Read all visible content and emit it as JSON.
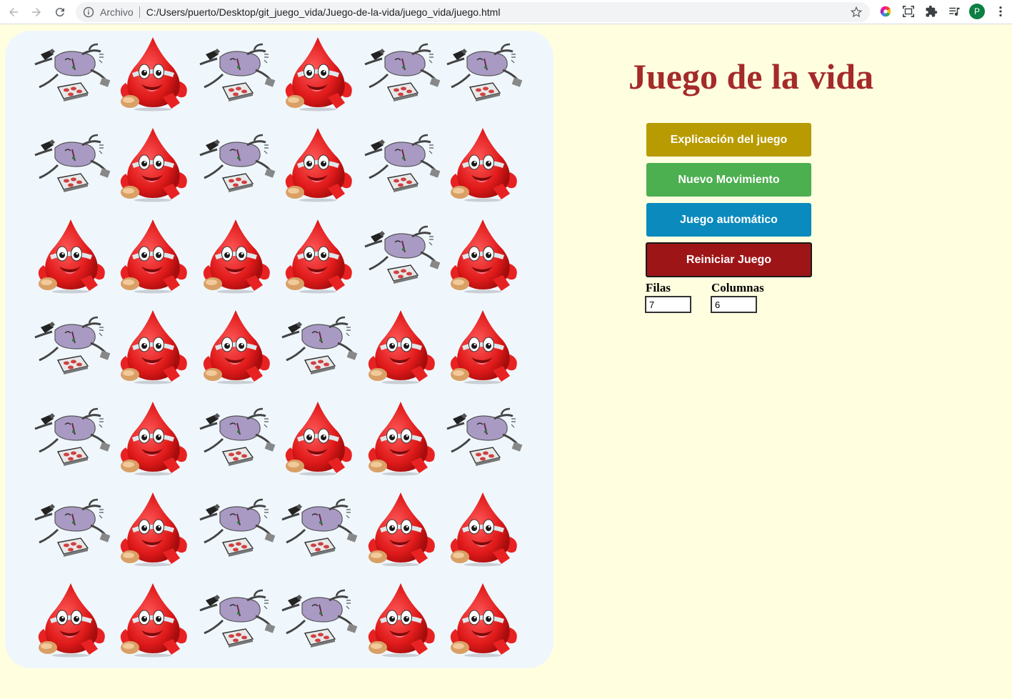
{
  "browser": {
    "protocol_label": "Archivo",
    "url": "C:/Users/puerto/Desktop/git_juego_vida/Juego-de-la-vida/juego_vida/juego.html",
    "profile_initial": "P"
  },
  "page": {
    "title": "Juego de la vida",
    "buttons": {
      "explain": "Explicación del juego",
      "next_move": "Nuevo Movimiento",
      "auto": "Juego automático",
      "reset": "Reiniciar Juego"
    },
    "rows_label": "Filas",
    "cols_label": "Columnas",
    "rows_value": "7",
    "cols_value": "6"
  },
  "board": {
    "rows": 7,
    "cols": 6,
    "cells": [
      [
        "dead",
        "alive",
        "dead",
        "alive",
        "dead",
        "dead"
      ],
      [
        "dead",
        "alive",
        "dead",
        "alive",
        "dead",
        "alive"
      ],
      [
        "alive",
        "alive",
        "alive",
        "alive",
        "dead",
        "alive"
      ],
      [
        "dead",
        "alive",
        "alive",
        "dead",
        "alive",
        "alive"
      ],
      [
        "dead",
        "alive",
        "dead",
        "alive",
        "alive",
        "dead"
      ],
      [
        "dead",
        "alive",
        "dead",
        "dead",
        "alive",
        "alive"
      ],
      [
        "alive",
        "alive",
        "dead",
        "dead",
        "alive",
        "alive"
      ]
    ]
  },
  "colors": {
    "page_bg": "#ffffe0",
    "board_bg": "#eff7fd",
    "title": "#a52a2a",
    "btn_explain": "#b89b00",
    "btn_next": "#4caf50",
    "btn_auto": "#0a8abd",
    "btn_reset": "#9e1518"
  }
}
